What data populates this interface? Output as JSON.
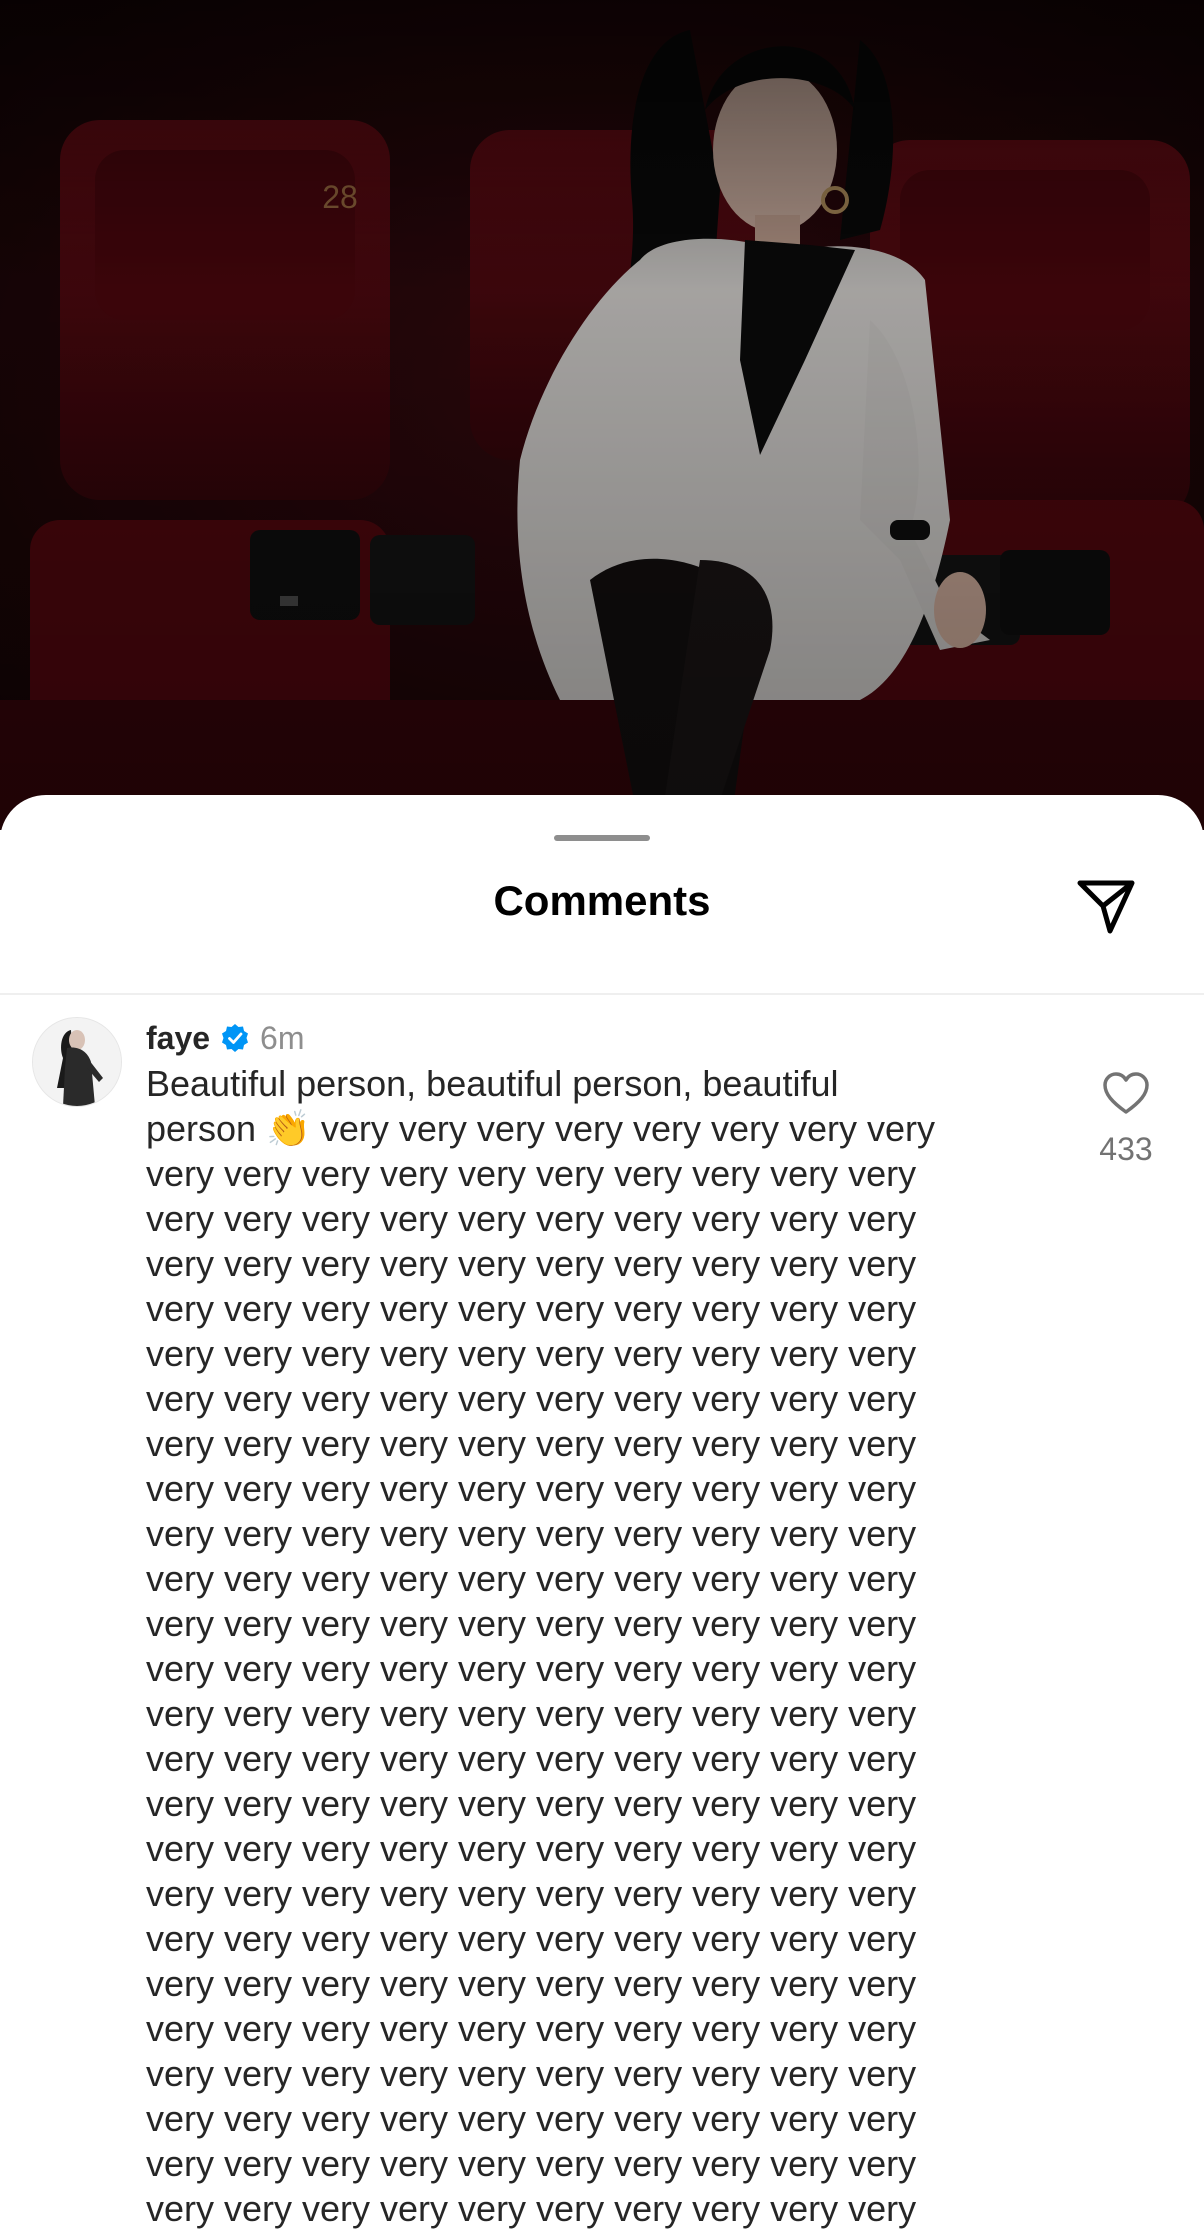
{
  "photo": {
    "seat_number": "28",
    "subject": "woman in white blazer seated in red cinema seat"
  },
  "sheet": {
    "title": "Comments",
    "share_icon": "send-paper-plane-icon"
  },
  "comment": {
    "username": "faye",
    "verified": true,
    "time": "6m",
    "lines": [
      "Beautiful person, beautiful person, beautiful",
      "person 👏 very very very very very very very very",
      "very very very very very very very very very very",
      "very very very very very very very very very very",
      "very very very very very very very very very very",
      "very very very very very very very very very very",
      "very very very very very very very very very very",
      "very very very very very very very very very very",
      "very very very very very very very very very very",
      "very very very very very very very very very very",
      "very very very very very very very very very very",
      "very very very very very very very very very very",
      "very very very very very very very very very very",
      "very very very very very very very very very very",
      "very very very very very very very very very very",
      "very very very very very very very very very very",
      "very very very very very very very very very very",
      "very very very very very very very very very very",
      "very very very very very very very very very very",
      "very very very very very very very very very very",
      "very very very very very very very very very very",
      "very very very very very very very very very very",
      "very very very very very very very very very very",
      "very very very very very very very very very very",
      "very very very very very very very very very very",
      "very very very very very very very very very very"
    ],
    "like_count": "433",
    "like_icon": "heart-outline-icon"
  },
  "colors": {
    "username": "#262626",
    "muted": "#8e8e8e",
    "verified_blue": "#0095f6",
    "seat_red": "#8b0f18"
  }
}
